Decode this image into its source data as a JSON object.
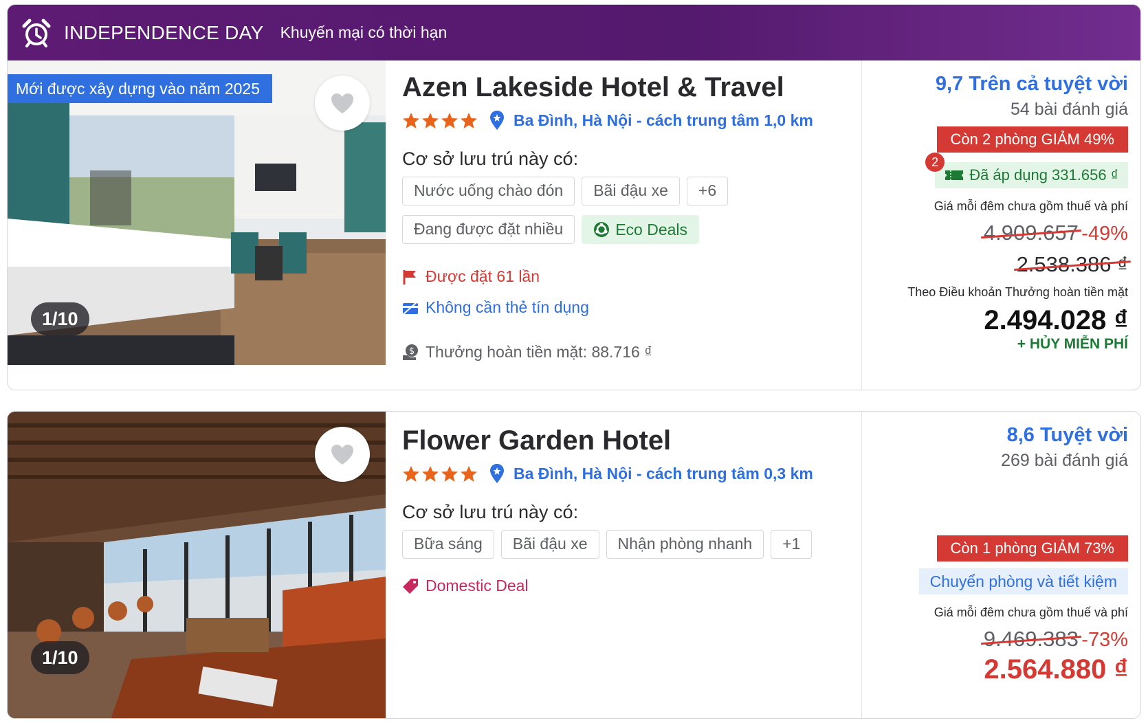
{
  "promo": {
    "title": "INDEPENDENCE DAY",
    "subtitle": "Khuyến mại có thời hạn"
  },
  "hotels": [
    {
      "new_badge": "Mới được xây dựng vào năm 2025",
      "photo_counter": "1/10",
      "name": "Azen Lakeside Hotel & Travel",
      "stars": 4,
      "location": "Ba Đình, Hà Nội - cách trung tâm 1,0 km",
      "amenities_title": "Cơ sở lưu trú này có:",
      "tags": [
        "Nước uống chào đón",
        "Bãi đậu xe",
        "+6"
      ],
      "popular_tag": "Đang được đặt nhiều",
      "eco_tag": "Eco Deals",
      "booked": "Được đặt 61 lần",
      "no_card": "Không cần thẻ tín dụng",
      "cashback": "Thưởng hoàn tiền mặt: 88.716 ₫",
      "rating": "9,7 Trên cả tuyệt vời",
      "reviews": "54 bài đánh giá",
      "rooms_left": "Còn 2 phòng GIẢM 49%",
      "coupon_count": "2",
      "applied": "Đã áp dụng 331.656 ₫",
      "per_night": "Giá mỗi đêm chưa gồm thuế và phí",
      "original_price": "4.909.657",
      "discount": "-49%",
      "crossed_price": "2.538.386 ₫",
      "terms": "Theo Điều khoản Thưởng hoàn tiền mặt",
      "final_price": "2.494.028 ₫",
      "free_cancel": "+ HỦY MIỄN PHÍ"
    },
    {
      "photo_counter": "1/10",
      "name": "Flower Garden Hotel",
      "stars": 4,
      "location": "Ba Đình, Hà Nội - cách trung tâm 0,3 km",
      "amenities_title": "Cơ sở lưu trú này có:",
      "tags": [
        "Bữa sáng",
        "Bãi đậu xe",
        "Nhận phòng nhanh",
        "+1"
      ],
      "deal": "Domestic Deal",
      "rating": "8,6 Tuyệt vời",
      "reviews": "269 bài đánh giá",
      "rooms_left": "Còn 1 phòng GIẢM 73%",
      "transfer": "Chuyển phòng và tiết kiệm",
      "per_night": "Giá mỗi đêm chưa gồm thuế và phí",
      "original_price": "9.469.383",
      "discount": "-73%",
      "final_price": "2.564.880 ₫"
    }
  ],
  "colors": {
    "brand_blue": "#2f6fe0",
    "promo_purple": "#5e1b74",
    "discount_red": "#d43a33",
    "green": "#1c7a35",
    "star_orange": "#e8641b"
  }
}
